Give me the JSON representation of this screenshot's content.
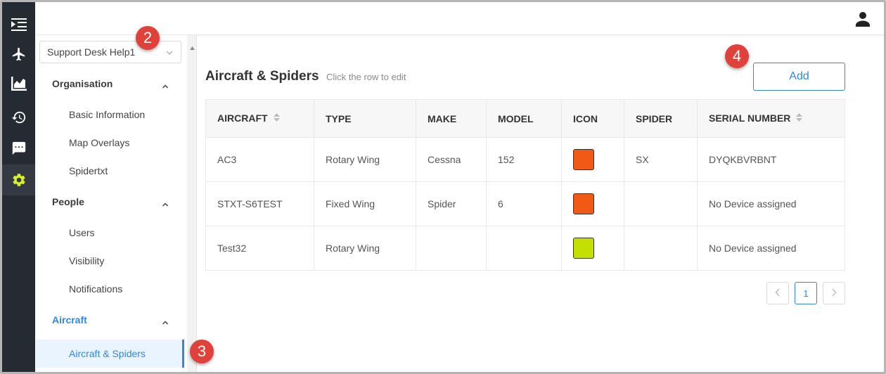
{
  "rail": {
    "items": [
      {
        "icon": "indent-menu-icon"
      },
      {
        "icon": "airplane-icon"
      },
      {
        "icon": "bar-chart-icon"
      },
      {
        "icon": "history-icon"
      },
      {
        "icon": "chat-icon"
      },
      {
        "icon": "gear-icon",
        "active": true
      }
    ],
    "active_color": "#d8ef2a"
  },
  "header": {
    "user_icon": "user-icon"
  },
  "sidebar": {
    "org_select": {
      "value": "Support Desk Help1"
    },
    "sections": [
      {
        "title": "Organisation",
        "items": [
          "Basic Information",
          "Map Overlays",
          "Spidertxt"
        ]
      },
      {
        "title": "People",
        "items": [
          "Users",
          "Visibility",
          "Notifications"
        ]
      },
      {
        "title": "Aircraft",
        "items": [
          "Aircraft & Spiders"
        ]
      }
    ]
  },
  "main": {
    "title": "Aircraft & Spiders",
    "hint": "Click the row to edit",
    "add_label": "Add",
    "table": {
      "columns": [
        "AIRCRAFT",
        "TYPE",
        "MAKE",
        "MODEL",
        "ICON",
        "SPIDER",
        "SERIAL NUMBER"
      ],
      "rows": [
        {
          "aircraft": "AC3",
          "type": "Rotary Wing",
          "make": "Cessna",
          "model": "152",
          "icon_color": "#f05a14",
          "spider": "SX",
          "serial": "DYQKBVRBNT"
        },
        {
          "aircraft": "STXT-S6TEST",
          "type": "Fixed Wing",
          "make": "Spider",
          "model": "6",
          "icon_color": "#f05a14",
          "spider": "",
          "serial": "No Device assigned"
        },
        {
          "aircraft": "Test32",
          "type": "Rotary Wing",
          "make": "",
          "model": "",
          "icon_color": "#c3e000",
          "spider": "",
          "serial": "No Device assigned"
        }
      ]
    },
    "pagination": {
      "current": "1"
    }
  },
  "callouts": [
    "2",
    "3",
    "4"
  ],
  "colors": {
    "accent": "#2f86e6",
    "rail_bg": "#252b33",
    "callout": "#e0413b"
  }
}
